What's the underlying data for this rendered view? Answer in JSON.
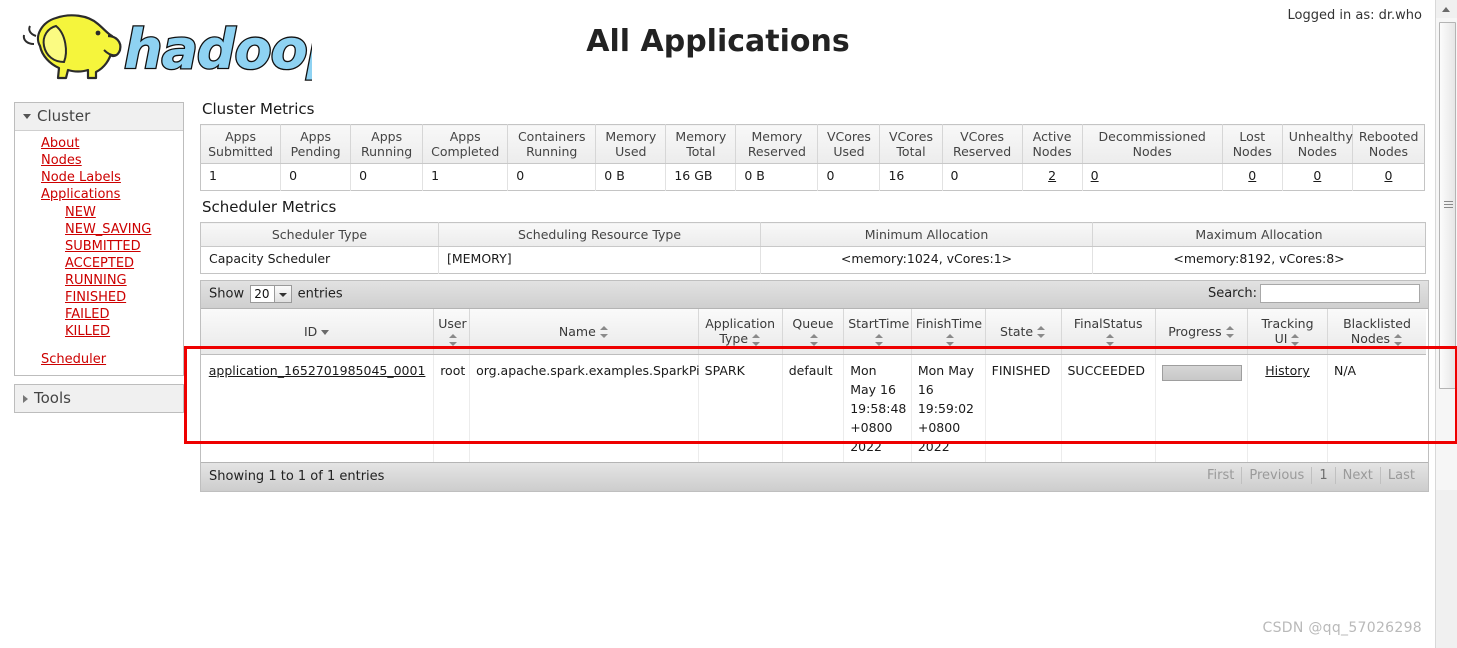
{
  "header": {
    "title": "All Applications",
    "logo_text": "hadoop",
    "logged_in": "Logged in as: dr.who"
  },
  "nav": {
    "cluster_label": "Cluster",
    "tools_label": "Tools",
    "items": [
      {
        "label": "About"
      },
      {
        "label": "Nodes"
      },
      {
        "label": "Node Labels"
      },
      {
        "label": "Applications"
      }
    ],
    "app_states": [
      {
        "label": "NEW"
      },
      {
        "label": "NEW_SAVING"
      },
      {
        "label": "SUBMITTED"
      },
      {
        "label": "ACCEPTED"
      },
      {
        "label": "RUNNING"
      },
      {
        "label": "FINISHED"
      },
      {
        "label": "FAILED"
      },
      {
        "label": "KILLED"
      }
    ],
    "scheduler_label": "Scheduler"
  },
  "cluster_metrics": {
    "title": "Cluster Metrics",
    "columns": [
      "Apps Submitted",
      "Apps Pending",
      "Apps Running",
      "Apps Completed",
      "Containers Running",
      "Memory Used",
      "Memory Total",
      "Memory Reserved",
      "VCores Used",
      "VCores Total",
      "VCores Reserved",
      "Active Nodes",
      "Decommissioned Nodes",
      "Lost Nodes",
      "Unhealthy Nodes",
      "Rebooted Nodes"
    ],
    "columns_lines": [
      [
        "Apps",
        "Submitted"
      ],
      [
        "Apps",
        "Pending"
      ],
      [
        "Apps",
        "Running"
      ],
      [
        "Apps",
        "Completed"
      ],
      [
        "Containers",
        "Running"
      ],
      [
        "Memory",
        "Used"
      ],
      [
        "Memory",
        "Total"
      ],
      [
        "Memory",
        "Reserved"
      ],
      [
        "VCores",
        "Used"
      ],
      [
        "VCores",
        "Total"
      ],
      [
        "VCores",
        "Reserved"
      ],
      [
        "Active",
        "Nodes"
      ],
      [
        "Decommissioned",
        "Nodes"
      ],
      [
        "Lost",
        "Nodes"
      ],
      [
        "Unhealthy",
        "Nodes"
      ],
      [
        "Rebooted",
        "Nodes"
      ]
    ],
    "values": [
      "1",
      "0",
      "0",
      "1",
      "0",
      "0 B",
      "16 GB",
      "0 B",
      "0",
      "16",
      "0",
      "2",
      "0",
      "0",
      "0",
      "0"
    ],
    "linked": [
      false,
      false,
      false,
      false,
      false,
      false,
      false,
      false,
      false,
      false,
      false,
      true,
      true,
      true,
      true,
      true
    ]
  },
  "scheduler_metrics": {
    "title": "Scheduler Metrics",
    "columns": [
      "Scheduler Type",
      "Scheduling Resource Type",
      "Minimum Allocation",
      "Maximum Allocation"
    ],
    "values": [
      "Capacity Scheduler",
      "[MEMORY]",
      "<memory:1024, vCores:1>",
      "<memory:8192, vCores:8>"
    ]
  },
  "datatable": {
    "show_label": "Show",
    "entries_value": "20",
    "entries_label": "entries",
    "search_label": "Search:",
    "search_value": "",
    "search_placeholder": "",
    "info": "Showing 1 to 1 of 1 entries",
    "paginate": {
      "first": "First",
      "previous": "Previous",
      "page": "1",
      "next": "Next",
      "last": "Last"
    },
    "columns": [
      {
        "label": "ID",
        "lines": [
          "ID"
        ],
        "sort": "desc"
      },
      {
        "label": "User",
        "lines": [
          "User"
        ],
        "sort": "both"
      },
      {
        "label": "Name",
        "lines": [
          "Name"
        ],
        "sort": "both"
      },
      {
        "label": "Application Type",
        "lines": [
          "Application",
          "Type"
        ],
        "sort": "both"
      },
      {
        "label": "Queue",
        "lines": [
          "Queue"
        ],
        "sort": "both"
      },
      {
        "label": "StartTime",
        "lines": [
          "StartTime"
        ],
        "sort": "both"
      },
      {
        "label": "FinishTime",
        "lines": [
          "FinishTime"
        ],
        "sort": "both"
      },
      {
        "label": "State",
        "lines": [
          "State"
        ],
        "sort": "both"
      },
      {
        "label": "FinalStatus",
        "lines": [
          "FinalStatus"
        ],
        "sort": "both"
      },
      {
        "label": "Progress",
        "lines": [
          "Progress"
        ],
        "sort": "both"
      },
      {
        "label": "Tracking UI",
        "lines": [
          "Tracking",
          "UI"
        ],
        "sort": "both"
      },
      {
        "label": "Blacklisted Nodes",
        "lines": [
          "Blacklisted",
          "Nodes"
        ],
        "sort": "both"
      }
    ],
    "rows": [
      {
        "id": "application_1652701985045_0001",
        "user": "root",
        "name": "org.apache.spark.examples.SparkPi",
        "app_type": "SPARK",
        "queue": "default",
        "start_time": "Mon May 16 19:58:48 +0800 2022",
        "finish_time": "Mon May 16 19:59:02 +0800 2022",
        "state": "FINISHED",
        "final_status": "SUCCEEDED",
        "progress": "",
        "tracking_ui": "History",
        "blacklisted_nodes": "N/A"
      }
    ]
  },
  "watermark": "CSDN @qq_57026298",
  "colors": {
    "highlight_box": "#ee0000",
    "link": "#cc0000",
    "logo_body": "#f4f43a",
    "logo_text": "#8ed2f2"
  }
}
